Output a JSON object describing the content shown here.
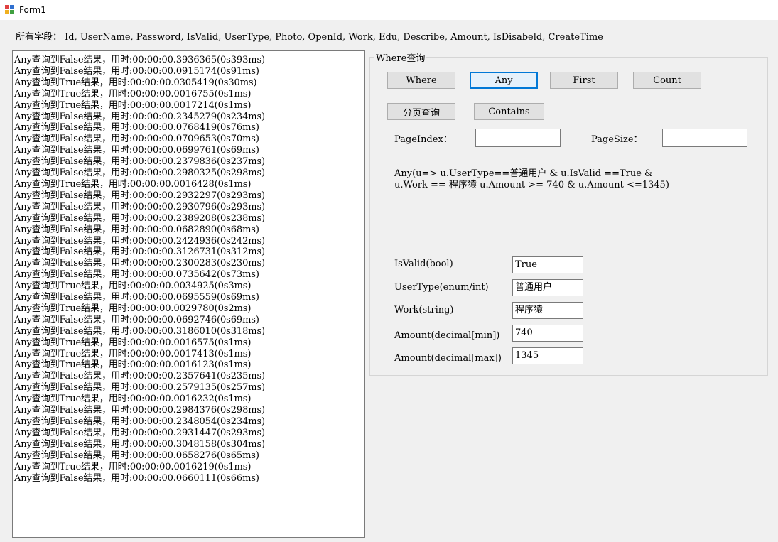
{
  "window": {
    "title": "Form1"
  },
  "fields_line": "所有字段：  Id, UserName, Password, IsValid, UserType, Photo, OpenId, Work, Edu, Describe, Amount, IsDisabeld, CreateTime",
  "log": [
    "Any查询到False结果，用时:00:00:00.3936365(0s393ms)",
    "Any查询到False结果，用时:00:00:00.0915174(0s91ms)",
    "Any查询到True结果，用时:00:00:00.0305419(0s30ms)",
    "Any查询到True结果，用时:00:00:00.0016755(0s1ms)",
    "Any查询到True结果，用时:00:00:00.0017214(0s1ms)",
    "Any查询到False结果，用时:00:00:00.2345279(0s234ms)",
    "Any查询到False结果，用时:00:00:00.0768419(0s76ms)",
    "Any查询到False结果，用时:00:00:00.0709653(0s70ms)",
    "Any查询到False结果，用时:00:00:00.0699761(0s69ms)",
    "Any查询到False结果，用时:00:00:00.2379836(0s237ms)",
    "Any查询到False结果，用时:00:00:00.2980325(0s298ms)",
    "Any查询到True结果，用时:00:00:00.0016428(0s1ms)",
    "Any查询到False结果，用时:00:00:00.2932297(0s293ms)",
    "Any查询到False结果，用时:00:00:00.2930796(0s293ms)",
    "Any查询到False结果，用时:00:00:00.2389208(0s238ms)",
    "Any查询到False结果，用时:00:00:00.0682890(0s68ms)",
    "Any查询到False结果，用时:00:00:00.2424936(0s242ms)",
    "Any查询到False结果，用时:00:00:00.3126731(0s312ms)",
    "Any查询到False结果，用时:00:00:00.2300283(0s230ms)",
    "Any查询到False结果，用时:00:00:00.0735642(0s73ms)",
    "Any查询到True结果，用时:00:00:00.0034925(0s3ms)",
    "Any查询到False结果，用时:00:00:00.0695559(0s69ms)",
    "Any查询到True结果，用时:00:00:00.0029780(0s2ms)",
    "Any查询到False结果，用时:00:00:00.0692746(0s69ms)",
    "Any查询到False结果，用时:00:00:00.3186010(0s318ms)",
    "Any查询到True结果，用时:00:00:00.0016575(0s1ms)",
    "Any查询到True结果，用时:00:00:00.0017413(0s1ms)",
    "Any查询到True结果，用时:00:00:00.0016123(0s1ms)",
    "Any查询到False结果，用时:00:00:00.2357641(0s235ms)",
    "Any查询到False结果，用时:00:00:00.2579135(0s257ms)",
    "Any查询到True结果，用时:00:00:00.0016232(0s1ms)",
    "Any查询到False结果，用时:00:00:00.2984376(0s298ms)",
    "Any查询到False结果，用时:00:00:00.2348054(0s234ms)",
    "Any查询到False结果，用时:00:00:00.2931447(0s293ms)",
    "Any查询到False结果，用时:00:00:00.3048158(0s304ms)",
    "Any查询到False结果，用时:00:00:00.0658276(0s65ms)",
    "Any查询到True结果，用时:00:00:00.0016219(0s1ms)",
    "Any查询到False结果，用时:00:00:00.0660111(0s66ms)"
  ],
  "group": {
    "title": "Where查询",
    "buttons": {
      "where": "Where",
      "any": "Any",
      "first": "First",
      "count": "Count",
      "paging": "分页查询",
      "contains": "Contains"
    },
    "page_index_label": "PageIndex：",
    "page_index_value": "",
    "page_size_label": "PageSize：",
    "page_size_value": "",
    "expression_line1": "Any(u=> u.UserType==普通用户 & u.IsValid ==True &",
    "expression_line2": "u.Work == 程序猿 u.Amount >= 740 & u.Amount <=1345)",
    "params": {
      "isvalid_label": "IsValid(bool)",
      "isvalid_value": "True",
      "usertype_label": "UserType(enum/int)",
      "usertype_value": "普通用户",
      "work_label": "Work(string)",
      "work_value": "程序猿",
      "amount_min_label": "Amount(decimal[min])",
      "amount_min_value": "740",
      "amount_max_label": "Amount(decimal[max])",
      "amount_max_value": "1345"
    }
  }
}
